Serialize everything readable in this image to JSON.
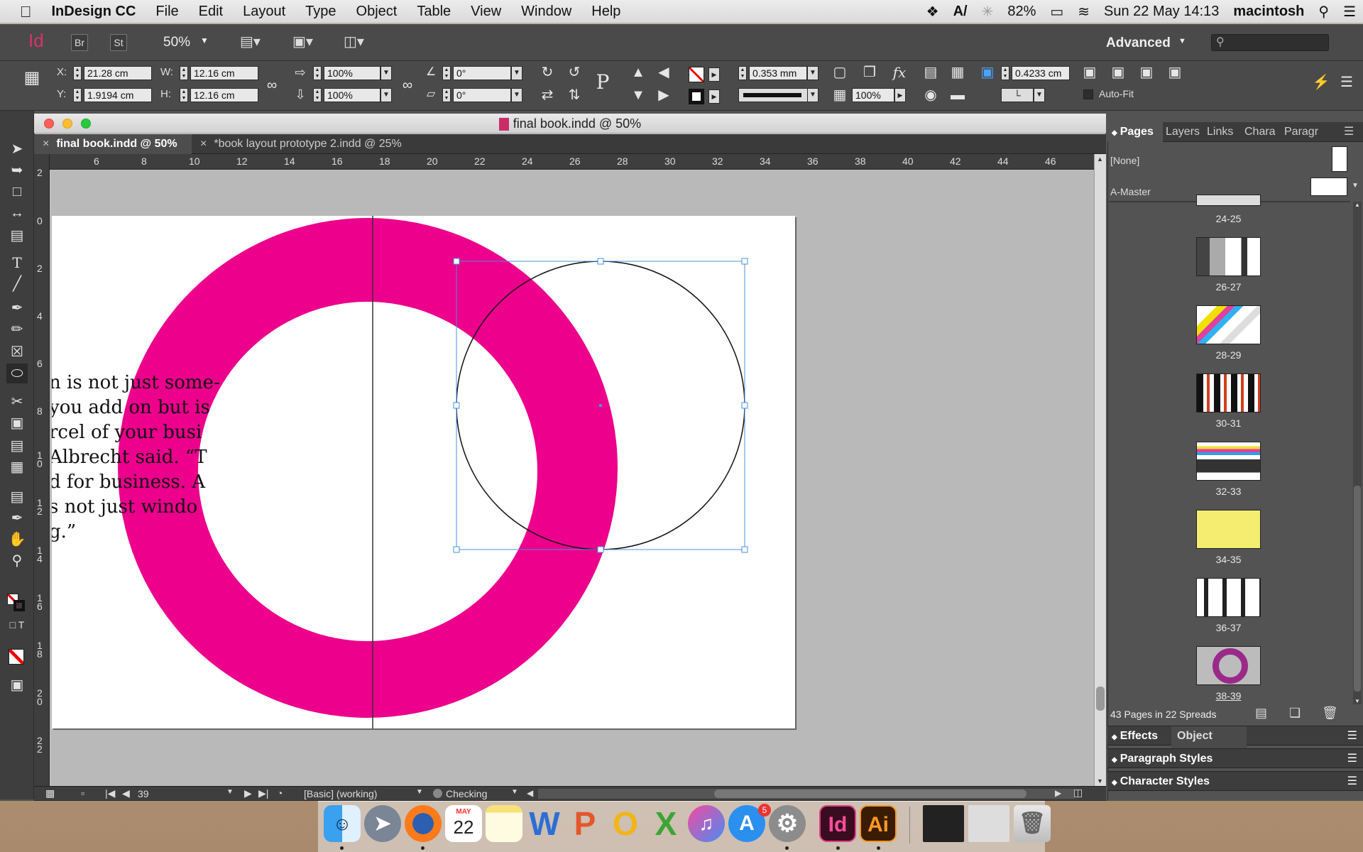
{
  "menubar": {
    "app_name": "InDesign CC",
    "menus": [
      "File",
      "Edit",
      "Layout",
      "Type",
      "Object",
      "Table",
      "View",
      "Window",
      "Help"
    ],
    "status": {
      "battery": "82%",
      "date_time": "Sun 22 May  14:13",
      "user": "macintosh"
    }
  },
  "control_bar": {
    "app_icon": "Id",
    "bridge": "Br",
    "stock": "St",
    "zoom": "50%",
    "workspace": "Advanced",
    "x_label": "X:",
    "x_value": "21.28 cm",
    "y_label": "Y:",
    "y_value": "1.9194 cm",
    "w_label": "W:",
    "w_value": "12.16 cm",
    "h_label": "H:",
    "h_value": "12.16 cm",
    "scale_x": "100%",
    "scale_y": "100%",
    "rotate": "0°",
    "shear": "0°",
    "stroke_weight": "0.353 mm",
    "opacity": "100%",
    "offset": "0.4233 cm",
    "auto_fit": "Auto-Fit"
  },
  "document": {
    "window_title": "final book.indd @ 50%",
    "tabs": [
      {
        "label": "final book.indd @ 50%",
        "active": true
      },
      {
        "label": "*book layout prototype 2.indd @ 25%",
        "active": false
      }
    ],
    "ruler_h": [
      "6",
      "8",
      "10",
      "12",
      "14",
      "16",
      "18",
      "20",
      "22",
      "24",
      "26",
      "28",
      "30",
      "32",
      "34",
      "36",
      "38",
      "40",
      "42",
      "44",
      "46"
    ],
    "ruler_v": [
      "2",
      "0",
      "2",
      "4",
      "6",
      "8",
      "1\n0",
      "1\n2",
      "1\n4",
      "1\n6",
      "1\n8",
      "2\n0",
      "2\n2"
    ],
    "body_text": "n is not just some-\nyou add on but is \nrcel of your busi\nAlbrecht said. “T\nd for business. A\ns not just windo\ng.”",
    "ring_color": "#ec008c"
  },
  "status_bar": {
    "page": "39",
    "preflight_profile": "[Basic] (working)",
    "preflight_status": "Checking"
  },
  "pages_panel": {
    "tabs": [
      "Pages",
      "Layers",
      "Links",
      "Chara",
      "Paragr"
    ],
    "masters": [
      "[None]",
      "A-Master"
    ],
    "spreads": [
      "24-25",
      "26-27",
      "28-29",
      "30-31",
      "32-33",
      "34-35",
      "36-37",
      "38-39"
    ],
    "summary": "43 Pages in 22 Spreads"
  },
  "collapsed_panels": {
    "effects": "Effects",
    "object_styles": "Object Styles",
    "paragraph_styles": "Paragraph Styles",
    "character_styles": "Character Styles"
  },
  "dock": {
    "apps": [
      "Finder",
      "Launchpad",
      "Firefox",
      "Calendar",
      "Notes",
      "Word",
      "PowerPoint",
      "Outlook",
      "Excel",
      "iTunes",
      "App Store",
      "System Preferences",
      "InDesign",
      "Illustrator"
    ],
    "calendar_month": "MAY",
    "calendar_day": "22",
    "appstore_badge": "5",
    "indesign_label": "Id",
    "illustrator_label": "Ai"
  }
}
